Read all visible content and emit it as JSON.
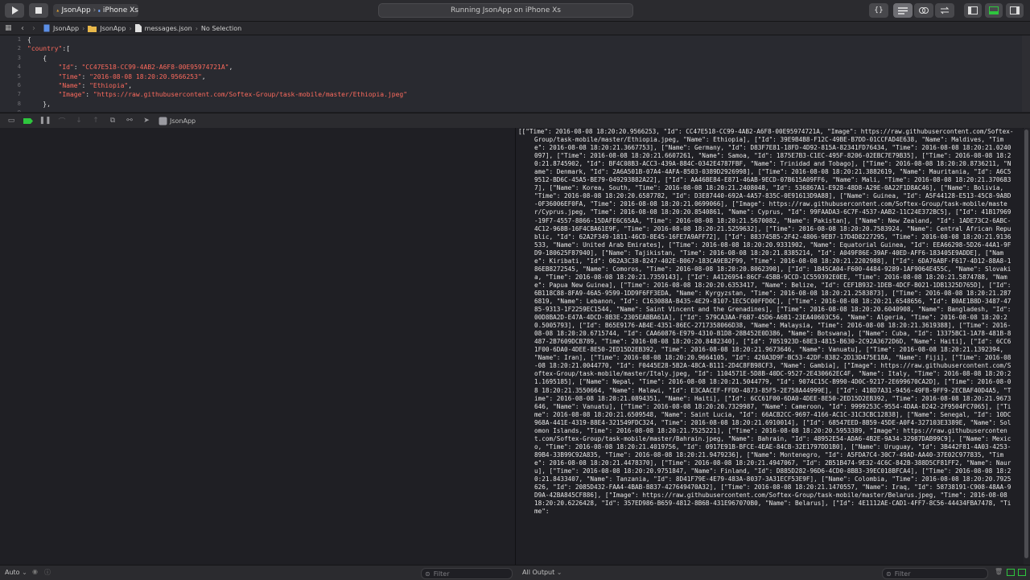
{
  "toolbar": {
    "scheme_target": "JsonApp",
    "device": "iPhone Xs",
    "activity_status": "Running JsonApp on iPhone Xs",
    "braces_label": "{}"
  },
  "jumpbar": {
    "items": [
      "JsonApp",
      "JsonApp",
      "messages.json",
      "No Selection"
    ]
  },
  "editor": {
    "line_numbers": [
      "1",
      "2",
      "3",
      "4",
      "5",
      "6",
      "7",
      "8",
      "9"
    ],
    "lines": [
      {
        "text": "{"
      },
      {
        "text": "\"country\":["
      },
      {
        "text": "    {"
      },
      {
        "text": "        \"Id\": \"CC47E518-CC99-4AB2-A6F8-00E95974721A\","
      },
      {
        "text": "        \"Time\": \"2016-08-08 18:20:20.9566253\","
      },
      {
        "text": "        \"Name\": \"Ethiopia\","
      },
      {
        "text": "        \"Image\": \"https://raw.githubusercontent.com/Softex-Group/task-mobile/master/Ethiopia.jpeg\""
      },
      {
        "text": "    },"
      },
      {
        "text": ""
      }
    ]
  },
  "debugbar": {
    "target": "JsonApp"
  },
  "bottom": {
    "auto_label": "Auto",
    "filter_left_placeholder": "Filter",
    "output_label": "All Output",
    "filter_right_placeholder": "Filter"
  },
  "console": {
    "output": "[[\"Time\": 2016-08-08 18:20:20.9566253, \"Id\": CC47E518-CC99-4AB2-A6F8-00E95974721A, \"Image\": https://raw.githubusercontent.com/Softex-Group/task-mobile/master/Ethiopia.jpeg, \"Name\": Ethiopia], [\"Id\": 39E9B4B8-F12C-49BE-B7DD-01CCFAD4E638, \"Name\": Maldives, \"Time\": 2016-08-08 18:20:21.3667753], [\"Name\": Germany, \"Id\": D83F7E81-18FD-4D92-815A-82341FD76434, \"Time\": 2016-08-08 18:20:21.0240097], [\"Time\": 2016-08-08 18:20:21.6607261, \"Name\": Samoa, \"Id\": 1875E7B3-C1EC-495F-8206-02EBC7E79B35], [\"Time\": 2016-08-08 18:20:21.8745902, \"Id\": BF4C08B3-ACC3-439A-884C-0342E4787FBF, \"Name\": Trinidad and Tobago], [\"Time\": 2016-08-08 18:20:20.8736211, \"Name\": Denmark, \"Id\": 2A6A501B-07A4-4AFA-8503-0389D2926998], [\"Time\": 2016-08-08 18:20:21.3882619, \"Name\": Mauritania, \"Id\": A6C59512-BD6C-45A5-BE79-049293882A22], [\"Id\": AA46BE84-E871-46AB-9ECD-07B615A09FF6, \"Name\": Mali, \"Time\": 2016-08-08 18:20:21.3706837], [\"Name\": Korea, South, \"Time\": 2016-08-08 18:20:21.2408048, \"Id\": 536867A1-E928-48D8-A29E-0A22F1D8AC46], [\"Name\": Bolivia, \"Time\": 2016-08-08 18:20:20.6587782, \"Id\": D3E87440-692A-4A57-835C-0E91613D9A88], [\"Name\": Guinea, \"Id\": A5F44128-E513-45C8-9A8D-0F36006EF0FA, \"Time\": 2016-08-08 18:20:21.0699066], [\"Image\": https://raw.githubusercontent.com/Softex-Group/task-mobile/master/Cyprus.jpeg, \"Time\": 2016-08-08 18:20:20.8540861, \"Name\": Cyprus, \"Id\": 99FAADA3-6C7F-4537-AAB2-11C24E372BC5], [\"Id\": 41B17969-19F7-4557-8866-15DAFE6C65AA, \"Time\": 2016-08-08 18:20:21.5670082, \"Name\": Pakistan], [\"Name\": New Zealand, \"Id\": 1ADE73C2-6ABC-4C12-968B-16F4CBA61E9F, \"Time\": 2016-08-08 18:20:21.5259632], [\"Time\": 2016-08-08 18:20:20.7583924, \"Name\": Central African Republic, \"Id\": 62A2F349-1811-46CD-8E45-16FE7A9AFF72], [\"Id\": 883745B5-2F42-4806-9EB7-17D4D8227295, \"Time\": 2016-08-08 18:20:21.9136533, \"Name\": United Arab Emirates], [\"Time\": 2016-08-08 18:20:20.9331902, \"Name\": Equatorial Guinea, \"Id\": EEA66298-5D26-44A1-9FD9-180625F87940], [\"Name\": Tajikistan, \"Time\": 2016-08-08 18:20:21.8385214, \"Id\": A049F86E-39AF-40ED-AFF6-183405E9ADDE], [\"Name\": Kiribati, \"Id\": 062A3C38-8247-402E-B067-183CA9EB2F99, \"Time\": 2016-08-08 18:20:21.2202988], [\"Id\": 6DA76ABF-F617-4D12-88A8-186EB8272545, \"Name\": Comoros, \"Time\": 2016-08-08 18:20:20.8062390], [\"Id\": 1B45CA04-F600-4484-9289-1AF9064E455C, \"Name\": Slovakia, \"Time\": 2016-08-08 18:20:21.7359143], [\"Id\": A4126954-86CF-45BB-9CCD-1C559392E0EE, \"Time\": 2016-08-08 18:20:21.5874788, \"Name\": Papua New Guinea], [\"Time\": 2016-08-08 18:20:20.6353417, \"Name\": Belize, \"Id\": CEF1B932-1DEB-4DCF-B021-1DB1325D765D], [\"Id\": 6B118C88-8FA9-46A5-9599-1DD9F6FF3EDA, \"Name\": Kyrgyzstan, \"Time\": 2016-08-08 18:20:21.2583873], [\"Time\": 2016-08-08 18:20:21.2876819, \"Name\": Lebanon, \"Id\": C163088A-B435-4E29-8107-1EC5C00FFD0C], [\"Time\": 2016-08-08 18:20:21.6548656, \"Id\": B0AE1B8D-3487-4785-9313-1F2259EC1544, \"Name\": Saint Vincent and the Grenadines], [\"Time\": 2016-08-08 18:20:20.6040908, \"Name\": Bangladesh, \"Id\": 00D8BA2D-E47A-4DCD-8B3E-2305EABBA61A], [\"Id\": 579CA3AA-F6B7-45D6-A6B1-23EA40603C56, \"Name\": Algeria, \"Time\": 2016-08-08 18:20:20.5005793], [\"Id\": B65E9176-AB4E-4351-86EC-2717358066D38, \"Name\": Malaysia, \"Time\": 2016-08-08 18:20:21.3619388], [\"Time\": 2016-08-08 18:20:20.6715744, \"Id\": CAA60876-E979-4310-B1D8-28B452E0D386, \"Name\": Botswana], [\"Name\": Cuba, \"Id\": 13375BC1-1A78-481B-8487-2B7609DCB789, \"Time\": 2016-08-08 18:20:20.8482340], [\"Id\": 7051923D-68E3-4815-B630-2C92A3672D6D, \"Name\": Haiti], [\"Id\": 6CC61F00-6DA0-4DEE-8E50-2ED15D2EB392, \"Time\": 2016-08-08 18:20:21.9673646, \"Name\": Vanuatu], [\"Time\": 2016-08-08 18:20:21.1392394, \"Name\": Iran], [\"Time\": 2016-08-08 18:20:20.9664105, \"Id\": 420A3D9F-BC53-42DF-8382-2D13D475E18A, \"Name\": Fiji], [\"Time\": 2016-08-08 18:20:21.0044770, \"Id\": F0445E28-5B2A-48CA-B111-2D4C8FB98CF3, \"Name\": Gambia], [\"Image\": https://raw.githubusercontent.com/Softex-Group/task-mobile/master/Italy.jpeg, \"Id\": 1104571E-5D8B-40DC-9527-2E430662EC4F, \"Name\": Italy, \"Time\": 2016-08-08 18:20:21.1695185], [\"Name\": Nepal, \"Time\": 2016-08-08 18:20:21.5044779, \"Id\": 9074C15C-B990-4D0C-9217-2E699670CA2D], [\"Time\": 2016-08-08 18:20:21.3550664, \"Name\": Malawi, \"Id\": E3CAACEF-FFDD-4873-85F5-2E758A44999E], [\"Id\": 418D7A31-9456-49FB-9FF9-2ECBAF40D4A5, \"Time\": 2016-08-08 18:20:21.0894351, \"Name\": Haiti], [\"Id\": 6CC61F00-6DA0-4DEE-8E50-2ED15D2EB392, \"Time\": 2016-08-08 18:20:21.9673646, \"Name\": Vanuatu], [\"Time\": 2016-08-08 18:20:20.7329987, \"Name\": Cameroon, \"Id\": 9999253C-9554-4DAA-8242-2F9504FC7065], [\"Time\": 2016-08-08 18:20:21.6509548, \"Name\": Saint Lucia, \"Id\": 66ACB2CC-9697-4166-AC1C-31C3CBC12838], [\"Name\": Senegal, \"Id\": 10DC968A-441E-4319-88E4-321549FDC324, \"Time\": 2016-08-08 18:20:21.6910014], [\"Id\": 68547EED-8B59-45DE-A0F4-327103E3389E, \"Name\": Solomon Islands, \"Time\": 2016-08-08 18:20:21.7525221], [\"Time\": 2016-08-08 18:20:20.5953389, \"Image\": https://raw.githubusercontent.com/Softex-Group/task-mobile/master/Bahrain.jpeg, \"Name\": Bahrain, \"Id\": 48952E54-ADA6-4B2E-9A34-32987DAB99C9], [\"Name\": Mexico, \"Time\": 2016-08-08 18:20:21.4019756, \"Id\": 0917E91B-BFCE-4EAE-84CB-32E1797DD1B0], [\"Name\": Uruguay, \"Id\": 3B442F81-4A03-4253-89B4-33B99C92A835, \"Time\": 2016-08-08 18:20:21.9479236], [\"Name\": Montenegro, \"Id\": A5FDA7C4-30C7-49AD-AA40-37E02C977835, \"Time\": 2016-08-08 18:20:21.4478370], [\"Time\": 2016-08-08 18:20:21.4947067, \"Id\": 2B51B474-9E32-4C6C-842B-388D5CF81FF2, \"Name\": Nauru], [\"Time\": 2016-08-08 18:20:20.9751847, \"Name\": Finland, \"Id\": D885D282-96D6-4CD0-8BB3-39EC018BFCA4], [\"Time\": 2016-08-08 18:20:21.8433407, \"Name\": Tanzania, \"Id\": 8D41F79E-4E79-483A-8037-3A31ECF53E9F], [\"Name\": Colombia, \"Time\": 2016-08-08 18:20:20.7925626, \"Id\": 2085D432-FAA4-4BAB-B837-427649470A32], [\"Time\": 2016-08-08 18:20:21.1470557, \"Name\": Iraq, \"Id\": 58738191-C908-48AA-9D9A-42BA845CF886], [\"Image\": https://raw.githubusercontent.com/Softex-Group/task-mobile/master/Belarus.jpeg, \"Time\": 2016-08-08 18:20:20.6226428, \"Id\": 357ED986-B659-4812-8B6B-431E967070B0, \"Name\": Belarus], [\"Id\": 4E1112AE-CAD1-4FF7-8C56-44434FBA7478, \"Time\":"
  },
  "colors": {
    "accent_green": "#2ec63e",
    "string_red": "#fc6a5d"
  }
}
